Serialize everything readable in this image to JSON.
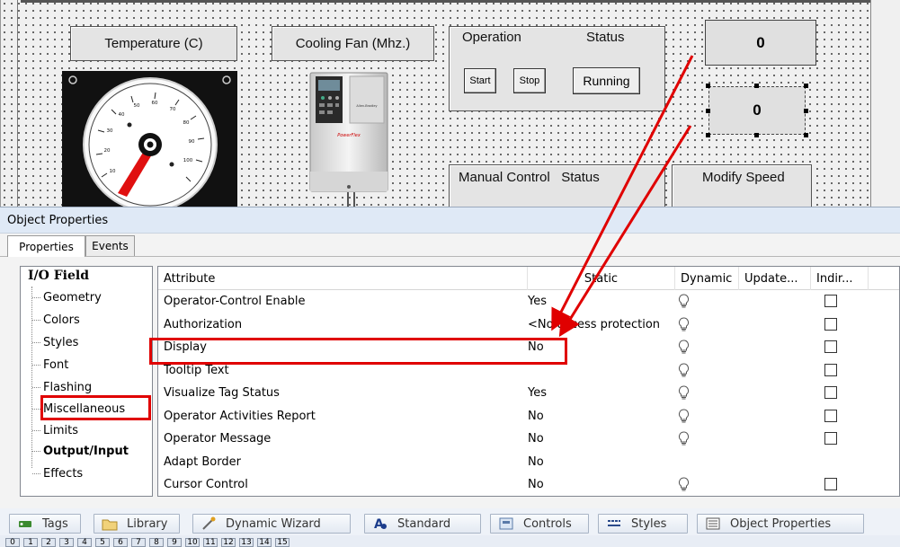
{
  "canvas": {
    "temperature_label": "Temperature (C)",
    "cooling_fan_label": "Cooling Fan (Mhz.)",
    "operation_group": {
      "title_left": "Operation",
      "title_right": "Status",
      "start": "Start",
      "stop": "Stop",
      "status_value": "Running"
    },
    "io_field_top": "0",
    "io_field_selected": "0",
    "manual_control_label": "Manual Control   Status",
    "modify_speed_label": "Modify Speed",
    "gauge_ticks": [
      "10",
      "20",
      "30",
      "40",
      "50",
      "60",
      "70",
      "80",
      "90",
      "100"
    ],
    "drive_brand": "PowerFlex"
  },
  "panel": {
    "title": "Object Properties",
    "tabs": [
      "Properties",
      "Events"
    ],
    "tree": {
      "root": "I/O Field",
      "items": [
        "Geometry",
        "Colors",
        "Styles",
        "Font",
        "Flashing",
        "Miscellaneous",
        "Limits",
        "Output/Input",
        "Effects"
      ]
    },
    "grid": {
      "headers": [
        "Attribute",
        "Static",
        "Dynamic",
        "Update...",
        "Indir..."
      ],
      "rows": [
        {
          "attribute": "Operator-Control Enable",
          "static": "Yes"
        },
        {
          "attribute": "Authorization",
          "static": "<No access protection"
        },
        {
          "attribute": "Display",
          "static": "No"
        },
        {
          "attribute": "Tooltip Text",
          "static": ""
        },
        {
          "attribute": "Visualize Tag Status",
          "static": "Yes"
        },
        {
          "attribute": "Operator Activities Report",
          "static": "No"
        },
        {
          "attribute": "Operator Message",
          "static": "No"
        },
        {
          "attribute": "Adapt Border",
          "static": "No"
        },
        {
          "attribute": "Cursor Control",
          "static": "No"
        }
      ]
    }
  },
  "bottom_tabs": [
    "Tags",
    "Library",
    "Dynamic Wizard",
    "Standard",
    "Controls",
    "Styles",
    "Object Properties"
  ],
  "layer_numbers": [
    "0",
    "1",
    "2",
    "3",
    "4",
    "5",
    "6",
    "7",
    "8",
    "9",
    "10",
    "11",
    "12",
    "13",
    "14",
    "15"
  ],
  "colors": {
    "highlight": "#e00000",
    "arrow": "#e00000",
    "gauge_needle": "#e01010"
  }
}
